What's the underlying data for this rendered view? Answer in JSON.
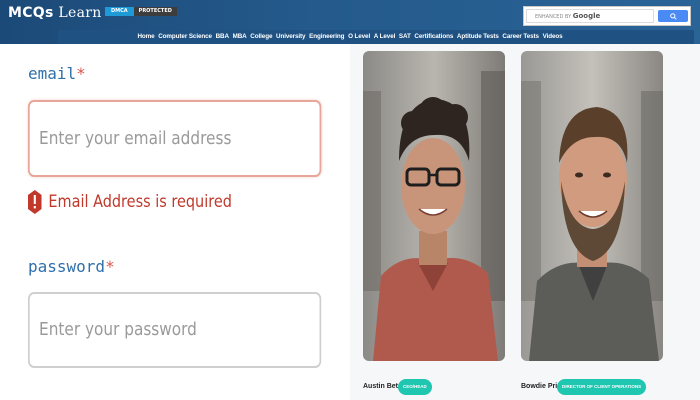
{
  "header": {
    "logo_main": "MCQs",
    "logo_rest": " Learn",
    "dmca_label": "DMCA",
    "protected_label": "PROTECTED",
    "search_prefix": "ENHANCED BY ",
    "search_brand": "Google"
  },
  "nav": {
    "items": [
      "Home",
      "Computer Science",
      "BBA",
      "MBA",
      "College",
      "University",
      "Engineering",
      "O Level",
      "A Level",
      "SAT",
      "Certifications",
      "Aptitude Tests",
      "Career Tests",
      "Videos"
    ]
  },
  "form": {
    "email_label": "email",
    "email_placeholder": "Enter your email address",
    "email_error": "Email Address is required",
    "password_label": "password",
    "password_placeholder": "Enter your password",
    "required_mark": "*"
  },
  "profiles": [
    {
      "name": "Austin Betzer",
      "role": "CEO/HEAD"
    },
    {
      "name": "Bowdie Price",
      "role": "DIRECTOR OF CLIENT OPERATIONS"
    }
  ],
  "colors": {
    "header_bg": "#245a8c",
    "label_blue": "#2f6fab",
    "error_red": "#c0392b",
    "badge_teal": "#1fc6b0"
  }
}
